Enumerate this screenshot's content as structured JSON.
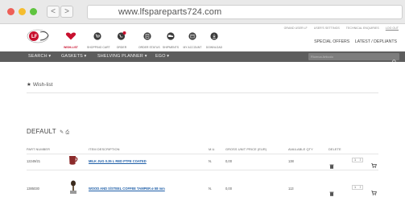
{
  "browser": {
    "url": "www.lfspareparts724.com",
    "back_glyph": "<",
    "forward_glyph": ">"
  },
  "header": {
    "logo_icon": "lf-logo-icon",
    "icons": [
      {
        "name": "wish-list",
        "label": "WISH-LIST",
        "icon": "heart-icon",
        "active": true
      },
      {
        "name": "shopping-cart",
        "label": "SHOPPING CART",
        "icon": "cart-circle-icon"
      },
      {
        "name": "order",
        "label": "ORDER",
        "icon": "cart-badge-icon"
      },
      {
        "name": "order-status",
        "label": "ORDER STATUS",
        "icon": "clipboard-icon"
      },
      {
        "name": "shipments",
        "label": "SHIPMENTS",
        "icon": "truck-icon"
      },
      {
        "name": "my-account",
        "label": "MY ACCOUNT",
        "icon": "calendar-icon"
      },
      {
        "name": "download",
        "label": "DOWNLOAD",
        "icon": "download-icon"
      }
    ],
    "top_links": [
      "GRAND USER LF",
      "USER'S SETTINGS",
      "TECHNICAL ENQUIRIES",
      "LOG OUT"
    ],
    "offers": [
      "SPECIAL OFFERS",
      "LATEST / DEPLIANTS"
    ]
  },
  "menu": {
    "items": [
      "SEARCH ▾",
      "GASKETS ▾",
      "SHELVING PLANNER ▾",
      "EGO ▾"
    ],
    "search_placeholder": "Ricerca Articolo"
  },
  "page": {
    "title": "Wish-list",
    "list_name": "DEFAULT"
  },
  "table": {
    "headers": [
      "PART NUMBER",
      "ITEM DESCRIPTION",
      "M.U.",
      "GROSS UNIT PRICE (EUR)",
      "AVAILABLE QTY",
      "DELETE"
    ],
    "rows": [
      {
        "part": "12249/21",
        "description": "MILK JUG 0.35 L RED PTFE COATED",
        "mu": "N.",
        "price": "0,00",
        "qty": "138",
        "order_qty": "1",
        "thumb": "milk-jug-icon"
      },
      {
        "part": "1385030",
        "description": "WOOD AND S/STEEL COFFEE TAMPER ø 58 mm",
        "mu": "N.",
        "price": "0,00",
        "qty": "113",
        "order_qty": "1",
        "thumb": "tamper-icon"
      }
    ]
  },
  "colors": {
    "brand_red": "#c8102e",
    "menu_bg": "#5d5d5d",
    "link_blue": "#1f5fa8"
  }
}
